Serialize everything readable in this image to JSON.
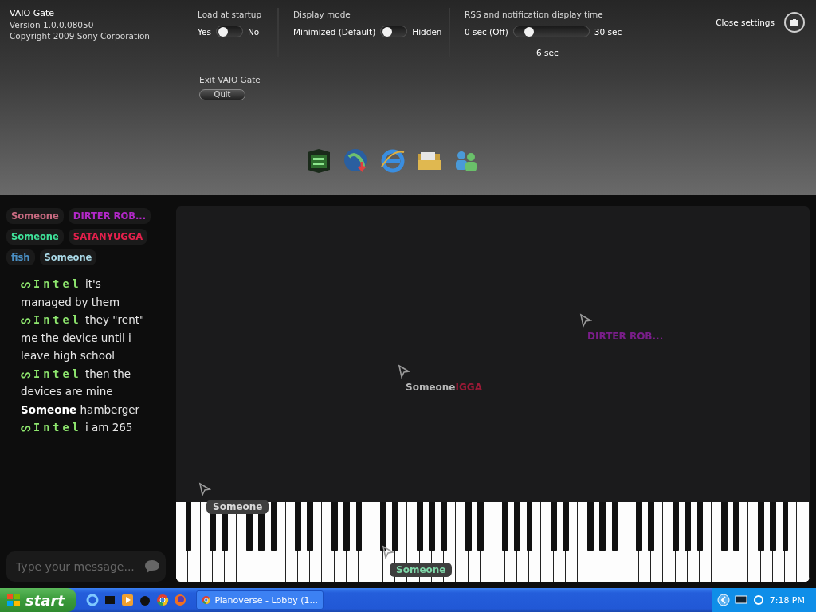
{
  "settings": {
    "app_title": "VAIO Gate",
    "version": "Version 1.0.0.08050",
    "copyright": "Copyright 2009 Sony Corporation",
    "load_at_startup": {
      "label": "Load at startup",
      "yes": "Yes",
      "no": "No",
      "on": true
    },
    "display_mode": {
      "label": "Display mode",
      "minimized": "Minimized (Default)",
      "hidden_label": "Hidden",
      "hidden": false
    },
    "rss_time": {
      "label": "RSS and notification display time",
      "min": "0 sec (Off)",
      "max": "30 sec",
      "reading": "6 sec",
      "level": 0.2
    },
    "exit": {
      "label": "Exit VAIO Gate",
      "button": "Quit"
    },
    "close": "Close settings"
  },
  "users": [
    {
      "name": "Someone",
      "color": "#c86a80"
    },
    {
      "name": "DIRTER ROB...",
      "color": "#b228c8"
    },
    {
      "name": "Someone",
      "color": "#3fe29a"
    },
    {
      "name": "SATANYUGGA",
      "color": "#e3204c"
    },
    {
      "name": "fish",
      "color": "#4a8fc4"
    },
    {
      "name": "Someone",
      "color": "#a9d8e6"
    }
  ],
  "messages": [
    {
      "kind": "fancy",
      "user": "ᔕIntel",
      "text": "it's managed by them"
    },
    {
      "kind": "fancy",
      "user": "ᔕIntel",
      "text": "they \"rent\" me the device until i leave high school"
    },
    {
      "kind": "fancy",
      "user": "ᔕIntel",
      "text": "then the devices are mine"
    },
    {
      "kind": "plain",
      "user": "Someone",
      "text": "hamberger"
    },
    {
      "kind": "fancy",
      "user": "ᔕIntel",
      "text": "i am 265"
    }
  ],
  "message_input": {
    "placeholder": "Type your message..."
  },
  "cursors": [
    {
      "labels": [
        {
          "text": "DIRTER ROB...",
          "color": "#7a1e8a"
        }
      ],
      "chip": false
    },
    {
      "labels": [
        {
          "text": "Someone",
          "color": "#b8b8b8"
        },
        {
          "text": "IGGA",
          "color": "#9a1a36"
        }
      ],
      "chip": false
    },
    {
      "labels": [
        {
          "text": "Someone",
          "color": "#d8d8d8"
        }
      ],
      "chip": true
    },
    {
      "labels": [
        {
          "text": "Someone",
          "color": "#7fd6a8"
        }
      ],
      "chip": true
    }
  ],
  "taskbar": {
    "start": "start",
    "task": "Pianoverse - Lobby (1...",
    "clock": "7:18 PM"
  }
}
